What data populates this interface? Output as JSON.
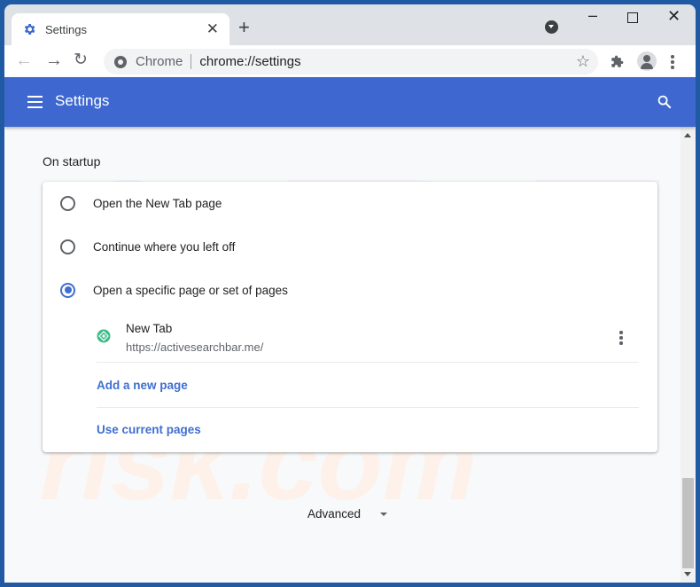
{
  "browser": {
    "tab_title": "Settings",
    "omnibox_scheme_label": "Chrome",
    "omnibox_url": "chrome://settings"
  },
  "settings": {
    "header_title": "Settings",
    "section_title": "On startup",
    "options": [
      {
        "label": "Open the New Tab page",
        "checked": false
      },
      {
        "label": "Continue where you left off",
        "checked": false
      },
      {
        "label": "Open a specific page or set of pages",
        "checked": true
      }
    ],
    "startup_pages": [
      {
        "name": "New Tab",
        "url": "https://activesearchbar.me/"
      }
    ],
    "add_page_label": "Add a new page",
    "use_current_label": "Use current pages",
    "advanced_label": "Advanced"
  },
  "colors": {
    "accent": "#3f6fd1",
    "header_bg": "#3e68cf",
    "favicon": "#3dbb8c"
  }
}
